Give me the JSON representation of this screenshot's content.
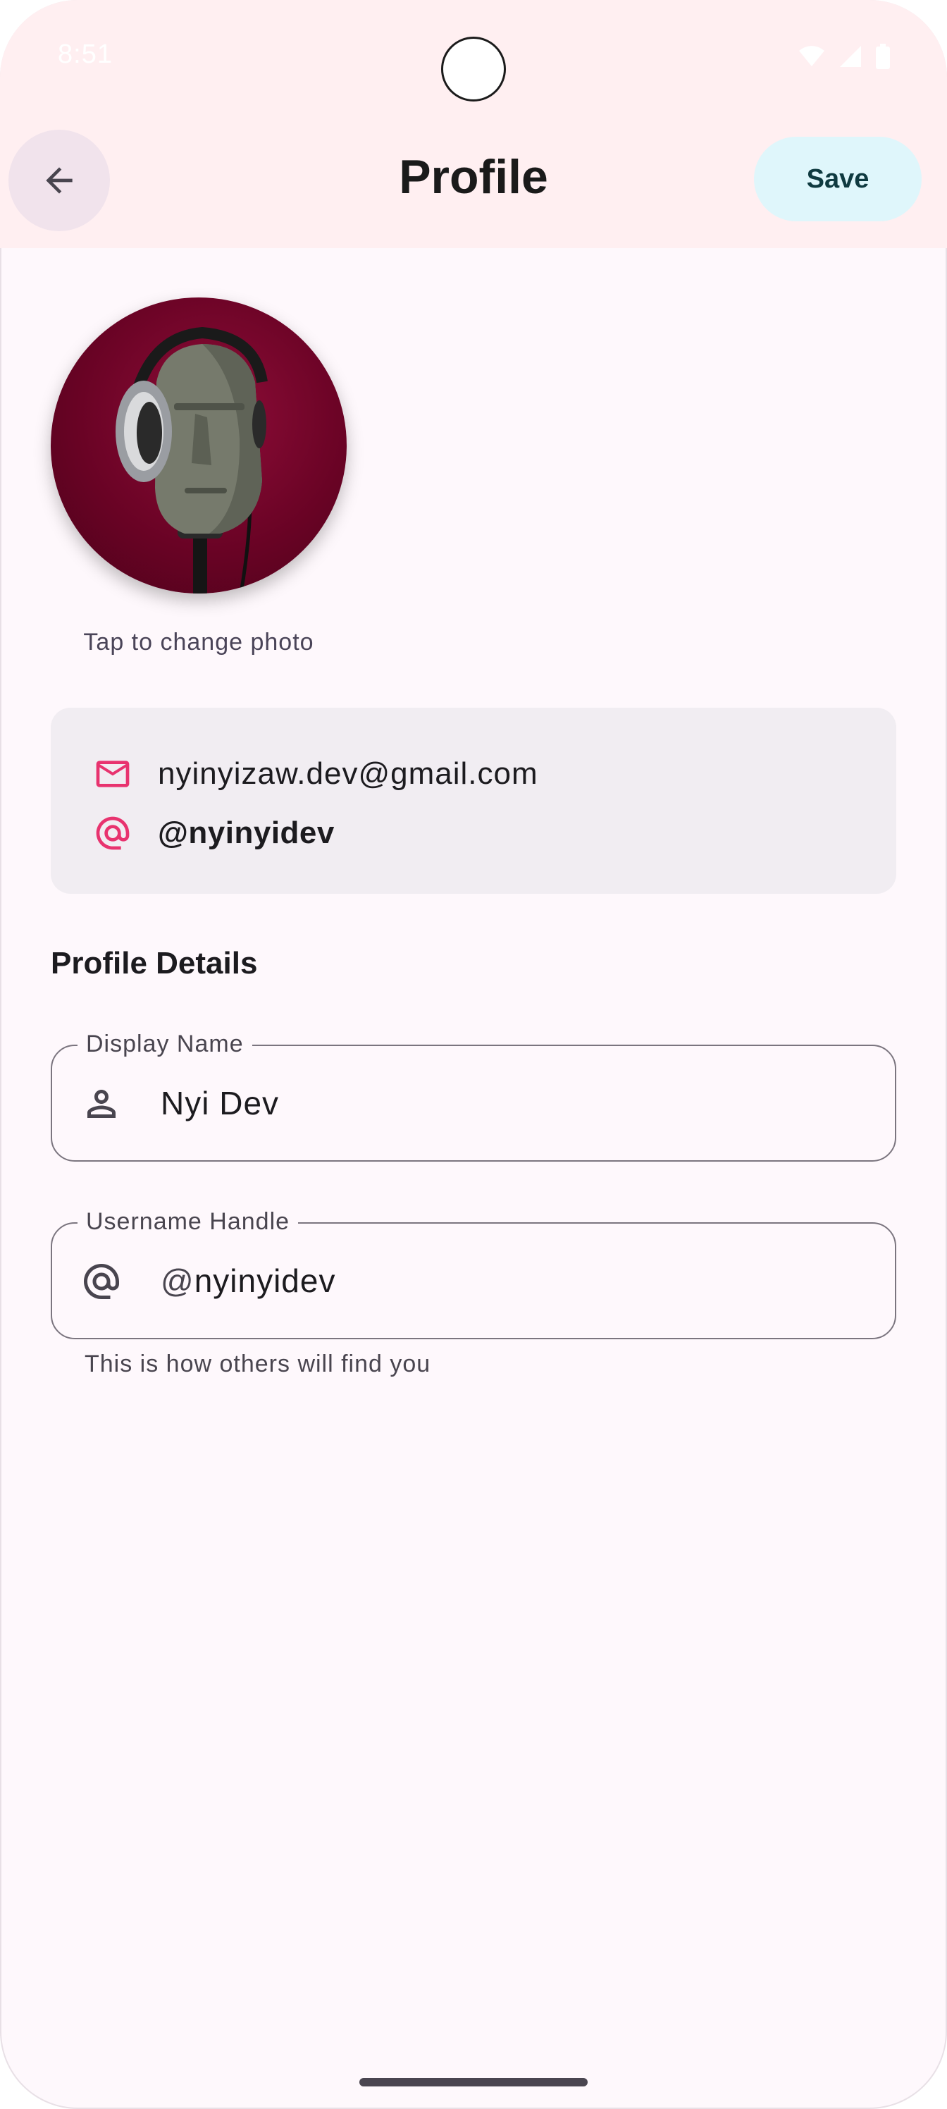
{
  "status_bar": {
    "time": "8:51"
  },
  "header": {
    "title": "Profile",
    "save_label": "Save"
  },
  "photo": {
    "hint": "Tap to change photo"
  },
  "account": {
    "email": "nyinyizaw.dev@gmail.com",
    "handle": "@nyinyidev"
  },
  "details": {
    "section_title": "Profile Details",
    "display_name": {
      "label": "Display Name",
      "value": "Nyi Dev"
    },
    "username": {
      "label": "Username Handle",
      "prefix": "@",
      "value": "nyinyidev",
      "supporting_text": "This is how others will find you"
    }
  },
  "colors": {
    "accent_pink": "#e8336f",
    "topbar_bg": "#ffeff1",
    "save_bg": "#dff6fb",
    "card_bg": "#f1edf2"
  }
}
